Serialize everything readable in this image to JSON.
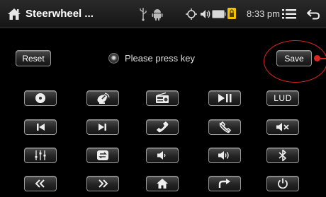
{
  "status_bar": {
    "title": "Steerwheel ...",
    "time": "8:33 pm",
    "icons": [
      "home-icon",
      "usb-icon",
      "android-icon",
      "gps-icon",
      "volume-icon",
      "battery-icon",
      "lock-icon",
      "menu-icon",
      "back-icon"
    ]
  },
  "controls": {
    "reset_label": "Reset",
    "save_label": "Save",
    "prompt": "Please press key"
  },
  "keys": [
    [
      {
        "name": "disc-key",
        "icon": "disc-icon"
      },
      {
        "name": "source-key",
        "icon": "satellite-icon"
      },
      {
        "name": "radio-key",
        "icon": "radio-icon"
      },
      {
        "name": "play-pause-key",
        "icon": "play-pause-icon"
      },
      {
        "name": "lud-key",
        "label": "LUD"
      }
    ],
    [
      {
        "name": "previous-key",
        "icon": "skip-previous-icon"
      },
      {
        "name": "next-key",
        "icon": "skip-next-icon"
      },
      {
        "name": "call-answer-key",
        "icon": "phone-icon"
      },
      {
        "name": "call-end-key",
        "icon": "phone-hangup-icon"
      },
      {
        "name": "mute-key",
        "icon": "mute-icon"
      }
    ],
    [
      {
        "name": "equalizer-key",
        "icon": "equalizer-icon"
      },
      {
        "name": "mode-key",
        "icon": "mode-switch-icon"
      },
      {
        "name": "volume-down-key",
        "icon": "volume-down-icon"
      },
      {
        "name": "volume-up-key",
        "icon": "volume-up-icon"
      },
      {
        "name": "bluetooth-key",
        "icon": "bluetooth-icon"
      }
    ],
    [
      {
        "name": "rewind-key",
        "icon": "rewind-icon"
      },
      {
        "name": "fast-forward-key",
        "icon": "fast-forward-icon"
      },
      {
        "name": "home-key",
        "icon": "home-icon"
      },
      {
        "name": "return-key",
        "icon": "return-icon"
      },
      {
        "name": "power-key",
        "icon": "power-icon"
      }
    ]
  ],
  "colors": {
    "highlight": "#e0241f",
    "background": "#000000",
    "button_border": "#9a9a9a"
  }
}
